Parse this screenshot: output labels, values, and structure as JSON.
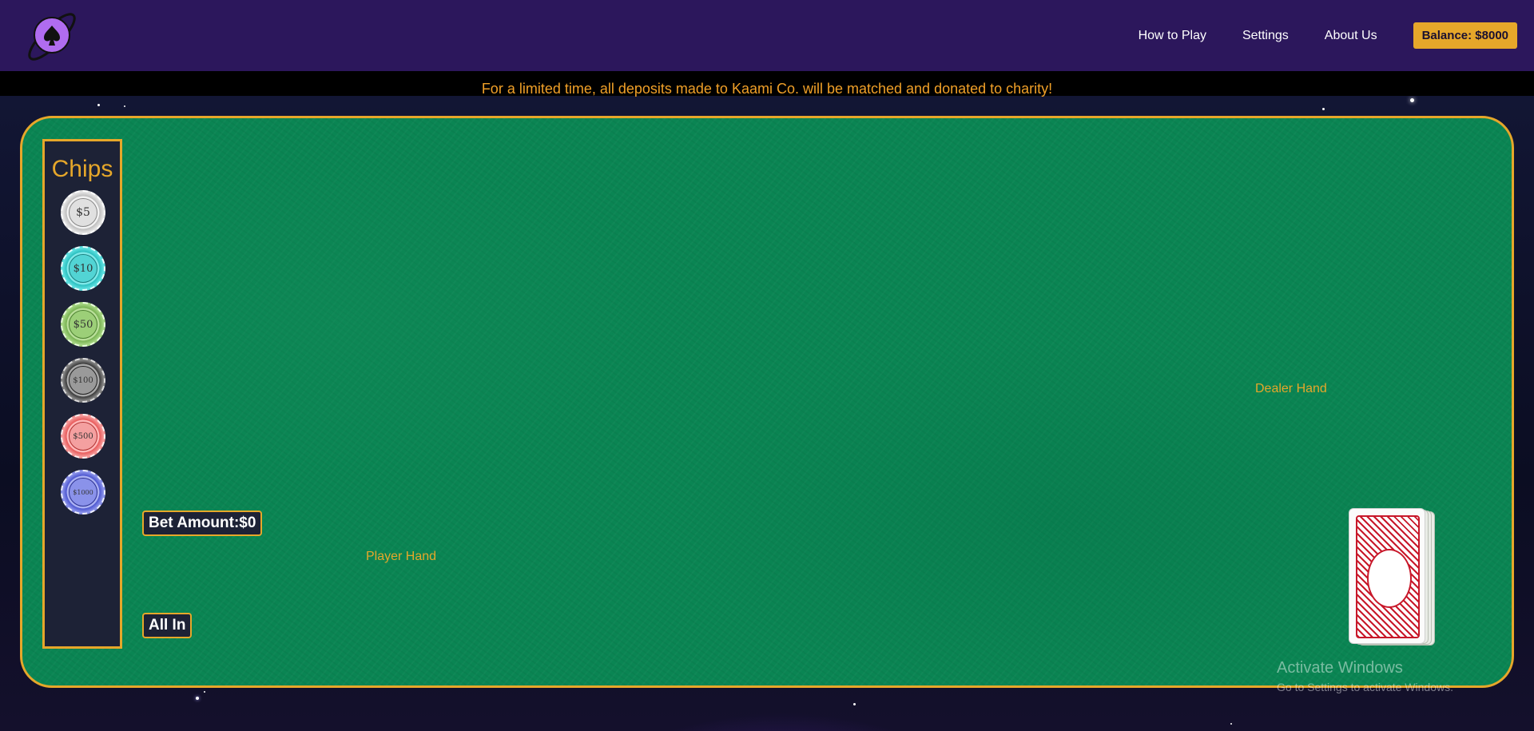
{
  "header": {
    "logo_icon": "planet-spade-logo-icon",
    "nav": {
      "how_to_play": "How to Play",
      "settings": "Settings",
      "about_us": "About Us"
    },
    "balance_label": "Balance: $8000"
  },
  "announcement": "For a limited time, all deposits made to Kaami Co. will be matched and donated to charity!",
  "chips": {
    "title": "Chips",
    "items": [
      {
        "label": "$5",
        "color": "#d9d9d9"
      },
      {
        "label": "$10",
        "color": "#4fd6d6"
      },
      {
        "label": "$50",
        "color": "#9ccf78"
      },
      {
        "label": "$100",
        "color": "#7a7a7a"
      },
      {
        "label": "$500",
        "color": "#f08a8a"
      },
      {
        "label": "$1000",
        "color": "#7c86e6"
      }
    ]
  },
  "table": {
    "bet_amount": "Bet Amount:$0",
    "all_in": "All In",
    "player_hand": "Player Hand",
    "dealer_hand": "Dealer Hand"
  },
  "watermark": {
    "title": "Activate Windows",
    "subtitle": "Go to Settings to activate Windows."
  },
  "colors": {
    "accent": "#e6a72a",
    "header_bg": "#2c175c",
    "felt": "#0a8553"
  }
}
